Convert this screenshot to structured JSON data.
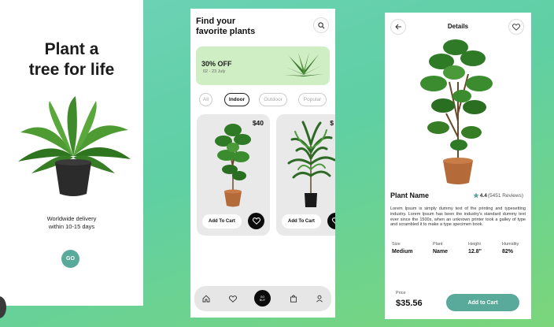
{
  "welcome": {
    "headline_line1": "Plant a",
    "headline_line2": "tree for life",
    "delivery_line1": "Worldwide delivery",
    "delivery_line2": "within 10-15 days",
    "go_label": "GO"
  },
  "browse": {
    "title_line1": "Find your",
    "title_line2": "favorite plants",
    "banner": {
      "discount": "30% OFF",
      "dates": "02 - 23 July"
    },
    "filters": [
      {
        "label": "All",
        "active": false
      },
      {
        "label": "Indoor",
        "active": true
      },
      {
        "label": "Outdoor",
        "active": false
      },
      {
        "label": "Popular",
        "active": false
      }
    ],
    "products": [
      {
        "price": "$40",
        "cart_label": "Add To Cart"
      },
      {
        "price": "$",
        "cart_label": "Add To Cart"
      }
    ],
    "tabbar": {
      "center_label_line1": "GO",
      "center_label_line2": "BUY"
    }
  },
  "details": {
    "header": "Details",
    "name": "Plant Name",
    "rating": "4.4",
    "reviews": "(5451 Reviews)",
    "description": "Lorem Ipsum is simply dummy text of the printing and typesetting industry. Lorem Ipsum has been the industry's standard dummy text ever since the 1500s, when an unknown printer took a galley of type and scrambled it to make a type specimen book.",
    "specs": [
      {
        "label": "Size",
        "value": "Medium"
      },
      {
        "label": "Plant",
        "value": "Name"
      },
      {
        "label": "Height",
        "value": "12.8\""
      },
      {
        "label": "Humidity",
        "value": "82%"
      }
    ],
    "price_label": "Price",
    "price": "$35.56",
    "add_label": "Add to Cart"
  },
  "colors": {
    "accent": "#5aaa9b",
    "banner": "#cfeec3",
    "card": "#e9e9e9",
    "dark": "#0c0c0c"
  },
  "icons": [
    "search-icon",
    "back-arrow-icon",
    "heart-icon",
    "star-icon",
    "home-icon",
    "bag-icon",
    "user-icon"
  ]
}
